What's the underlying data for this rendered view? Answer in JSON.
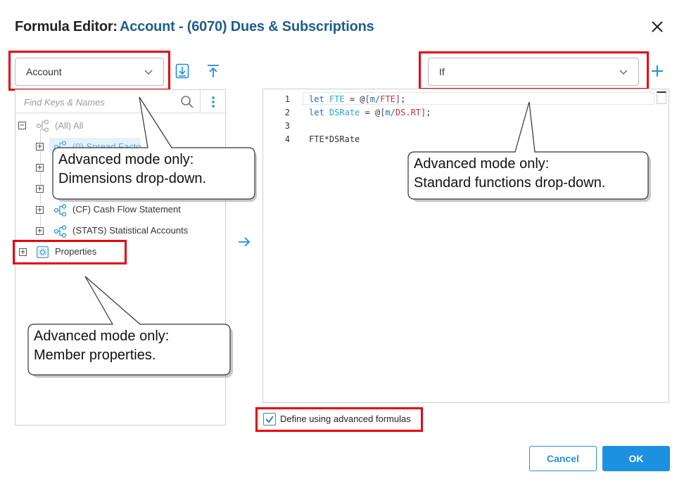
{
  "header": {
    "label": "Formula Editor:",
    "title": "Account - (6070) Dues & Subscriptions"
  },
  "dimension_select": {
    "value": "Account"
  },
  "function_select": {
    "value": "If"
  },
  "search": {
    "placeholder": "Find Keys & Names"
  },
  "tree": [
    {
      "label": "(All) All",
      "state": "dim",
      "toggle": "−"
    },
    {
      "label": "(0) Spread Facto",
      "state": "selected",
      "toggle": "+"
    },
    {
      "label": "",
      "toggle": "+"
    },
    {
      "label": "",
      "toggle": "+"
    },
    {
      "label": "(CF) Cash Flow Statement",
      "toggle": "+"
    },
    {
      "label": "(STATS) Statistical Accounts",
      "toggle": "+"
    }
  ],
  "properties": {
    "label": "Properties",
    "toggle": "+"
  },
  "editor": {
    "line_numbers": [
      "1",
      "2",
      "3",
      "4"
    ],
    "lines": [
      {
        "kw": "let",
        "var": "FTE",
        "eq": " = ",
        "at": "@",
        "lb": "[",
        "dim": "m/",
        "fld": "FTE",
        "rb": "]",
        "end": ";"
      },
      {
        "kw": "let",
        "var": "DSRate",
        "eq": " = ",
        "at": "@",
        "lb": "[",
        "dim": "m/",
        "fld": "DS.RT",
        "rb": "]",
        "end": ";"
      },
      {
        "plain": ""
      },
      {
        "plain": "FTE*DSRate"
      }
    ]
  },
  "advanced_checkbox": {
    "label": "Define using advanced formulas",
    "checked": true
  },
  "buttons": {
    "cancel": "Cancel",
    "ok": "OK"
  },
  "callouts": {
    "dimensions": {
      "line1": "Advanced mode only:",
      "line2": "Dimensions drop-down."
    },
    "functions": {
      "line1": "Advanced mode only:",
      "line2": "Standard functions drop-down."
    },
    "properties": {
      "line1": "Advanced mode only:",
      "line2": "Member properties."
    }
  },
  "colors": {
    "accent": "#1e90e0",
    "highlight": "#e8000b",
    "title": "#1f5e8c"
  }
}
